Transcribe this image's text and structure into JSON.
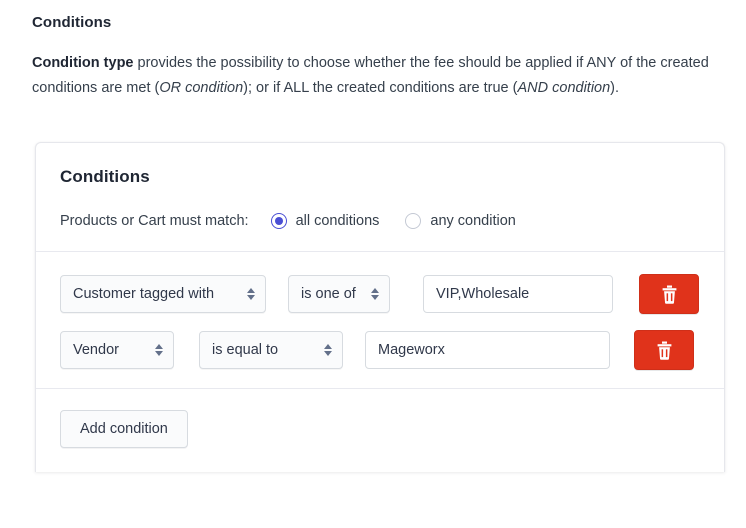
{
  "doc": {
    "heading": "Conditions",
    "paragraph": {
      "bold_lead": "Condition type",
      "part1": " provides the possibility to choose whether the fee should be applied if ANY of the created conditions are met (",
      "em1": "OR condition",
      "part2": "); or if ALL the created conditions are true (",
      "em2": "AND condition",
      "part3": ")."
    }
  },
  "card": {
    "title": "Conditions",
    "match": {
      "label": "Products or Cart must match:",
      "options": [
        {
          "label": "all conditions",
          "selected": true
        },
        {
          "label": "any condition",
          "selected": false
        }
      ]
    },
    "conditions": [
      {
        "attribute": "Customer tagged with",
        "operator": "is one of",
        "value": "VIP,Wholesale",
        "delete_icon": "trash-icon"
      },
      {
        "attribute": "Vendor",
        "operator": "is equal to",
        "value": "Mageworx",
        "delete_icon": "trash-icon"
      }
    ],
    "add_condition_label": "Add condition"
  },
  "colors": {
    "accent_radio": "#4a4fd4",
    "danger": "#e0331b",
    "text": "#36404c",
    "heading": "#1f2633",
    "border": "#d7dbe0",
    "card_border": "#e6e7ec",
    "divider": "#e8e9ef",
    "control_bg": "#fafbfc"
  }
}
